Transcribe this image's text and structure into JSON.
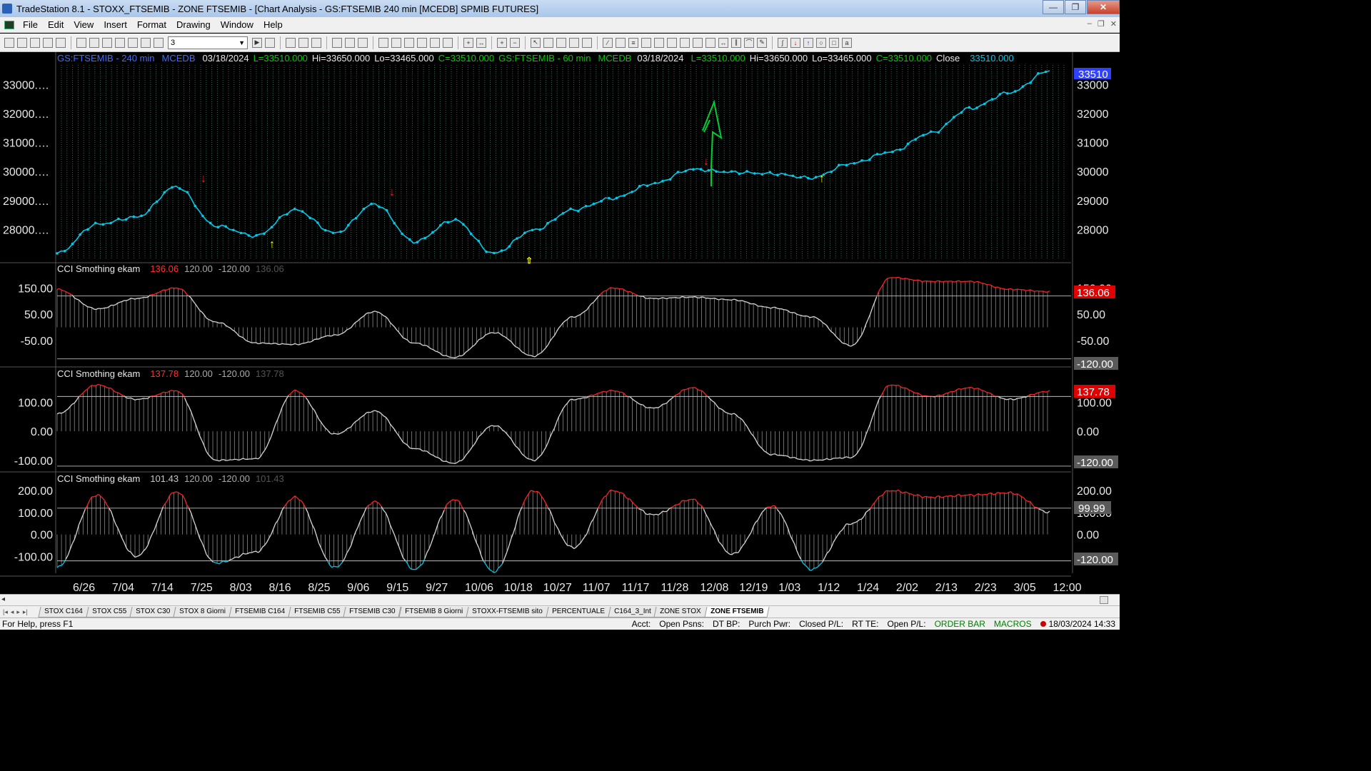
{
  "window": {
    "title": "TradeStation 8.1 - STOXX_FTSEMIB - ZONE FTSEMIB - [Chart Analysis - GS:FTSEMIB  240 min  [MCEDB] SPMIB FUTURES]",
    "minimize": "—",
    "maximize": "❐",
    "close": "✕"
  },
  "menu": [
    "File",
    "Edit",
    "View",
    "Insert",
    "Format",
    "Drawing",
    "Window",
    "Help"
  ],
  "toolbar": {
    "combo_value": "3"
  },
  "price_header": {
    "s1_symbol": "GS:FTSEMIB - 240 min",
    "s1_src": "MCEDB",
    "s1_date": "03/18/2024",
    "s1_last": "L=33510.000",
    "s1_hi": "Hi=33650.000",
    "s1_lo": "Lo=33465.000",
    "s1_close": "C=33510.000",
    "s2_symbol": "GS:FTSEMIB - 60 min",
    "s2_src": "MCEDB",
    "s2_date": "03/18/2024",
    "s2_last": "L=33510.000",
    "s2_hi": "Hi=33650.000",
    "s2_lo": "Lo=33465.000",
    "s2_close": "C=33510.000",
    "close_label": "Close",
    "close_value": "33510.000",
    "last_badge": "33510"
  },
  "panes": [
    {
      "label": "CCI Smothing ekam",
      "v1": "136.06",
      "v2": "120.00",
      "v3": "-120.00",
      "v4": "136.06",
      "v1_color": "#ff3030",
      "badge_top": "136.06",
      "badge_bot": "-120.00"
    },
    {
      "label": "CCI Smothing ekam",
      "v1": "137.78",
      "v2": "120.00",
      "v3": "-120.00",
      "v4": "137.78",
      "v1_color": "#ff3030",
      "badge_top": "137.78",
      "badge_bot": "-120.00"
    },
    {
      "label": "CCI Smothing ekam",
      "v1": "101.43",
      "v2": "120.00",
      "v3": "-120.00",
      "v4": "101.43",
      "v1_color": "#c8c8c8",
      "badge_top": "99.99",
      "badge_bot": "-120.00"
    }
  ],
  "price_axis": [
    "33000.…",
    "32000.…",
    "31000.…",
    "30000.…",
    "29000.…",
    "28000.…"
  ],
  "price_axis_right": [
    "33000",
    "32000",
    "31000",
    "30000",
    "29000",
    "28000"
  ],
  "cci1_axis": [
    "150.00",
    "50.00",
    "-50.00"
  ],
  "cci2_axis": [
    "100.00",
    "0.00",
    "-100.00"
  ],
  "cci3_axis": [
    "200.00",
    "100.00",
    "0.00",
    "-100.00"
  ],
  "time_axis": [
    "6/26",
    "7/04",
    "7/14",
    "7/25",
    "8/03",
    "8/16",
    "8/25",
    "9/06",
    "9/15",
    "9/27",
    "10/06",
    "10/18",
    "10/27",
    "11/07",
    "11/17",
    "11/28",
    "12/08",
    "12/19",
    "1/03",
    "1/12",
    "1/24",
    "2/02",
    "2/13",
    "2/23",
    "3/05",
    "12:00"
  ],
  "chart_data": [
    {
      "type": "line",
      "title": "GS:FTSEMIB - 240 min",
      "ylim": [
        27000,
        33700
      ],
      "x": [
        "6/26",
        "7/04",
        "7/14",
        "7/25",
        "8/03",
        "8/16",
        "8/25",
        "9/06",
        "9/15",
        "9/27",
        "10/06",
        "10/18",
        "10/27",
        "11/07",
        "11/17",
        "11/28",
        "12/08",
        "12/19",
        "1/03",
        "1/12",
        "1/24",
        "2/02",
        "2/13",
        "2/23",
        "3/05",
        "3/18"
      ],
      "series": [
        {
          "values": [
            27200,
            28200,
            28450,
            29500,
            28150,
            27800,
            28700,
            27900,
            28900,
            27600,
            28350,
            27200,
            28000,
            28700,
            29100,
            29600,
            30100,
            30000,
            29950,
            29800,
            30300,
            30700,
            31350,
            32200,
            32750,
            33500
          ]
        }
      ]
    },
    {
      "type": "area",
      "title": "CCI Smothing ekam",
      "ylim": [
        -140,
        200
      ],
      "x": [
        "6/26",
        "7/04",
        "7/14",
        "7/25",
        "8/03",
        "8/16",
        "8/25",
        "9/06",
        "9/15",
        "9/27",
        "10/06",
        "10/18",
        "10/27",
        "11/07",
        "11/17",
        "11/28",
        "12/08",
        "12/19",
        "1/03",
        "1/12",
        "1/24",
        "2/02",
        "2/13",
        "2/23",
        "3/05",
        "3/18"
      ],
      "series": [
        {
          "values": [
            145,
            70,
            110,
            150,
            20,
            -60,
            -65,
            -30,
            60,
            -60,
            -115,
            -20,
            -110,
            40,
            150,
            110,
            115,
            105,
            75,
            40,
            -70,
            190,
            175,
            175,
            145,
            136
          ]
        }
      ]
    },
    {
      "type": "area",
      "title": "CCI Smothing ekam",
      "ylim": [
        -130,
        180
      ],
      "x": [
        "6/26",
        "7/04",
        "7/14",
        "7/25",
        "8/03",
        "8/16",
        "8/25",
        "9/06",
        "9/15",
        "9/27",
        "10/06",
        "10/18",
        "10/27",
        "11/07",
        "11/17",
        "11/28",
        "12/08",
        "12/19",
        "1/03",
        "1/12",
        "1/24",
        "2/02",
        "2/13",
        "2/23",
        "3/05",
        "3/18"
      ],
      "series": [
        {
          "values": [
            60,
            160,
            110,
            140,
            -100,
            -95,
            140,
            -10,
            70,
            -60,
            -110,
            20,
            -100,
            110,
            140,
            80,
            150,
            60,
            -80,
            -100,
            -90,
            160,
            120,
            150,
            110,
            138
          ]
        }
      ]
    },
    {
      "type": "area",
      "title": "CCI Smothing ekam",
      "ylim": [
        -170,
        230
      ],
      "x": [
        "6/26",
        "7/04",
        "7/14",
        "7/25",
        "8/03",
        "8/16",
        "8/25",
        "9/06",
        "9/15",
        "9/27",
        "10/06",
        "10/18",
        "10/27",
        "11/07",
        "11/17",
        "11/28",
        "12/08",
        "12/19",
        "1/03",
        "1/12",
        "1/24",
        "2/02",
        "2/13",
        "2/23",
        "3/05",
        "3/18"
      ],
      "series": [
        {
          "values": [
            -150,
            180,
            -100,
            195,
            -130,
            -80,
            170,
            -150,
            150,
            -160,
            160,
            -170,
            200,
            -60,
            200,
            90,
            160,
            -90,
            130,
            -160,
            50,
            200,
            170,
            180,
            190,
            101
          ]
        }
      ]
    }
  ],
  "tabs": [
    "STOX C164",
    "STOX C55",
    "STOX C30",
    "STOX 8 Giorni",
    "FTSEMIB C164",
    "FTSEMIB C55",
    "FTSEMIB C30",
    "FTSEMIB 8 Giorni",
    "STOXX-FTSEMIB sito",
    "PERCENTUALE",
    "C164_3_Int",
    "ZONE STOX",
    "ZONE FTSEMIB"
  ],
  "status": {
    "help": "For Help, press F1",
    "acct": "Acct:",
    "open_psns": "Open Psns:",
    "dt_bp": "DT BP:",
    "purch_pwr": "Purch Pwr:",
    "closed_pl": "Closed P/L:",
    "rt_te": "RT TE:",
    "open_pl": "Open P/L:",
    "order_bar": "ORDER BAR",
    "macros": "MACROS",
    "datetime": "18/03/2024 14:33"
  },
  "colors": {
    "price_line": "#00c8e8",
    "grid_vertical": "#2c6e5c",
    "cci_overbought": "#ff2020",
    "cci_oversold": "#00c8e8",
    "cci_line": "#d8d8d8",
    "annotation": "#00cc33",
    "up_arrow": "#ffff00",
    "down_arrow": "#ff2020"
  }
}
